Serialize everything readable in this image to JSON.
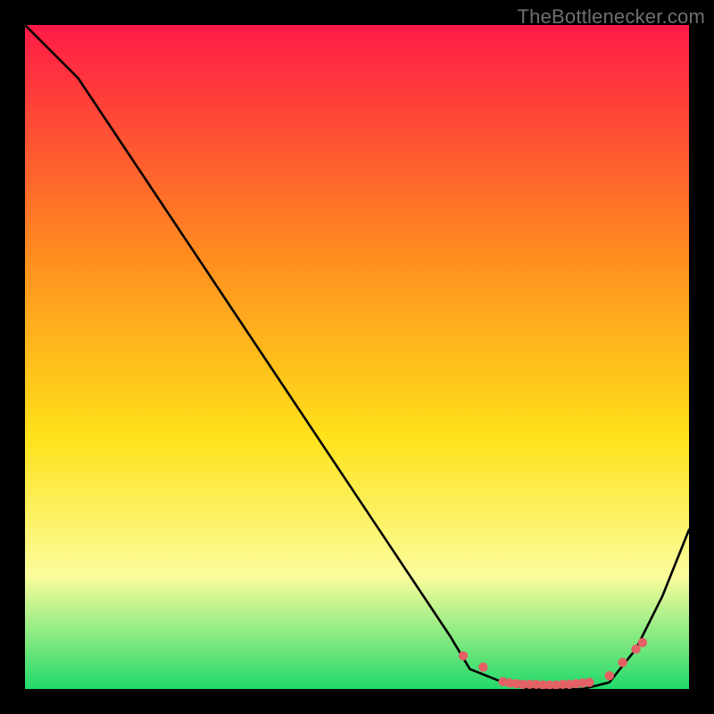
{
  "watermark": "TheBottlenecker.com",
  "colors": {
    "gradient_top": "#ff1a47",
    "gradient_mid1": "#ff8a1f",
    "gradient_mid2": "#ffe21a",
    "gradient_soft_yellow": "#fbfd9c",
    "gradient_bottom": "#21d96a",
    "curve": "#000000",
    "marker": "#e36165",
    "frame": "#000000"
  },
  "chart_data": {
    "type": "line",
    "title": "",
    "xlabel": "",
    "ylabel": "",
    "xlim": [
      0,
      100
    ],
    "ylim": [
      0,
      100
    ],
    "grid": false,
    "legend": false,
    "series": [
      {
        "name": "bottleneck-curve",
        "x": [
          0,
          8,
          16,
          24,
          32,
          40,
          48,
          56,
          64,
          67,
          72,
          76,
          80,
          84,
          88,
          92,
          96,
          100
        ],
        "y": [
          100,
          92,
          80,
          68,
          56,
          44,
          32,
          20,
          8,
          3,
          1,
          0,
          0,
          0,
          1,
          6,
          14,
          24
        ]
      }
    ],
    "markers": [
      {
        "name": "optimal-range-points",
        "x": [
          66,
          69,
          72,
          73,
          74,
          75,
          76,
          77,
          78,
          79,
          80,
          81,
          82,
          83,
          84,
          85,
          88,
          90,
          92,
          93
        ],
        "y": [
          5,
          3.3,
          1.1,
          0.9,
          0.8,
          0.7,
          0.7,
          0.7,
          0.6,
          0.6,
          0.6,
          0.7,
          0.7,
          0.8,
          0.9,
          1.0,
          2,
          4,
          6,
          7
        ]
      }
    ]
  }
}
